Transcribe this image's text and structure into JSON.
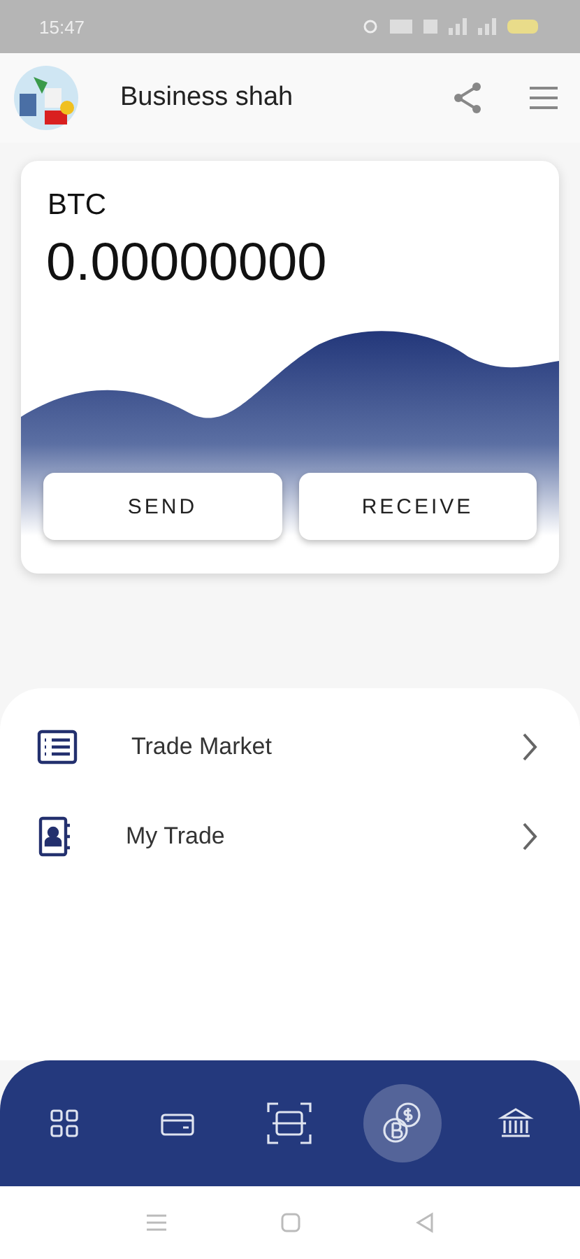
{
  "status_bar": {
    "time": "15:47"
  },
  "header": {
    "title": "Business shah"
  },
  "wallet": {
    "currency": "BTC",
    "balance": "0.00000000",
    "buttons": [
      "SEND",
      "RECEIVE"
    ]
  },
  "menu": [
    {
      "kind": "list",
      "label": "Trade Market"
    },
    {
      "kind": "contact",
      "label": "My Trade"
    }
  ],
  "bottom_nav": [
    {
      "kind": "grid",
      "selected": false
    },
    {
      "kind": "card",
      "selected": false
    },
    {
      "kind": "scan",
      "selected": false
    },
    {
      "kind": "coins",
      "selected": true
    },
    {
      "kind": "bank",
      "selected": false
    }
  ]
}
